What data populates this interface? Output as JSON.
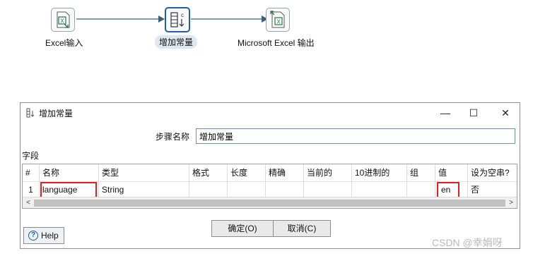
{
  "canvas": {
    "steps": [
      {
        "label": "Excel输入",
        "icon": "excel-input-icon",
        "glyph": "X"
      },
      {
        "label": "增加常量",
        "icon": "add-constants-icon",
        "glyph": "c"
      },
      {
        "label": "Microsoft Excel 输出",
        "icon": "excel-output-icon",
        "glyph": "X"
      }
    ]
  },
  "dialog": {
    "title": "增加常量",
    "minimize": "—",
    "maximize": "☐",
    "close": "✕",
    "step_name_label": "步骤名称",
    "step_name_value": "增加常量",
    "fields_label": "字段",
    "table": {
      "columns": [
        "#",
        "名称",
        "类型",
        "格式",
        "长度",
        "精确",
        "当前的",
        "10进制的",
        "组",
        "值",
        "设为空串?"
      ],
      "rows": [
        [
          "1",
          "language",
          "String",
          "",
          "",
          "",
          "",
          "",
          "",
          "en",
          "否"
        ]
      ]
    },
    "scroll_left": "<",
    "scroll_right": ">",
    "ok_button": "确定(O)",
    "cancel_button": "取消(C)",
    "help_button": "Help",
    "help_glyph": "?"
  },
  "watermark": "CSDN @幸娟呀",
  "colors": {
    "accent": "#1d5fa8",
    "highlight": "#e02020",
    "excel_green": "#217346"
  }
}
